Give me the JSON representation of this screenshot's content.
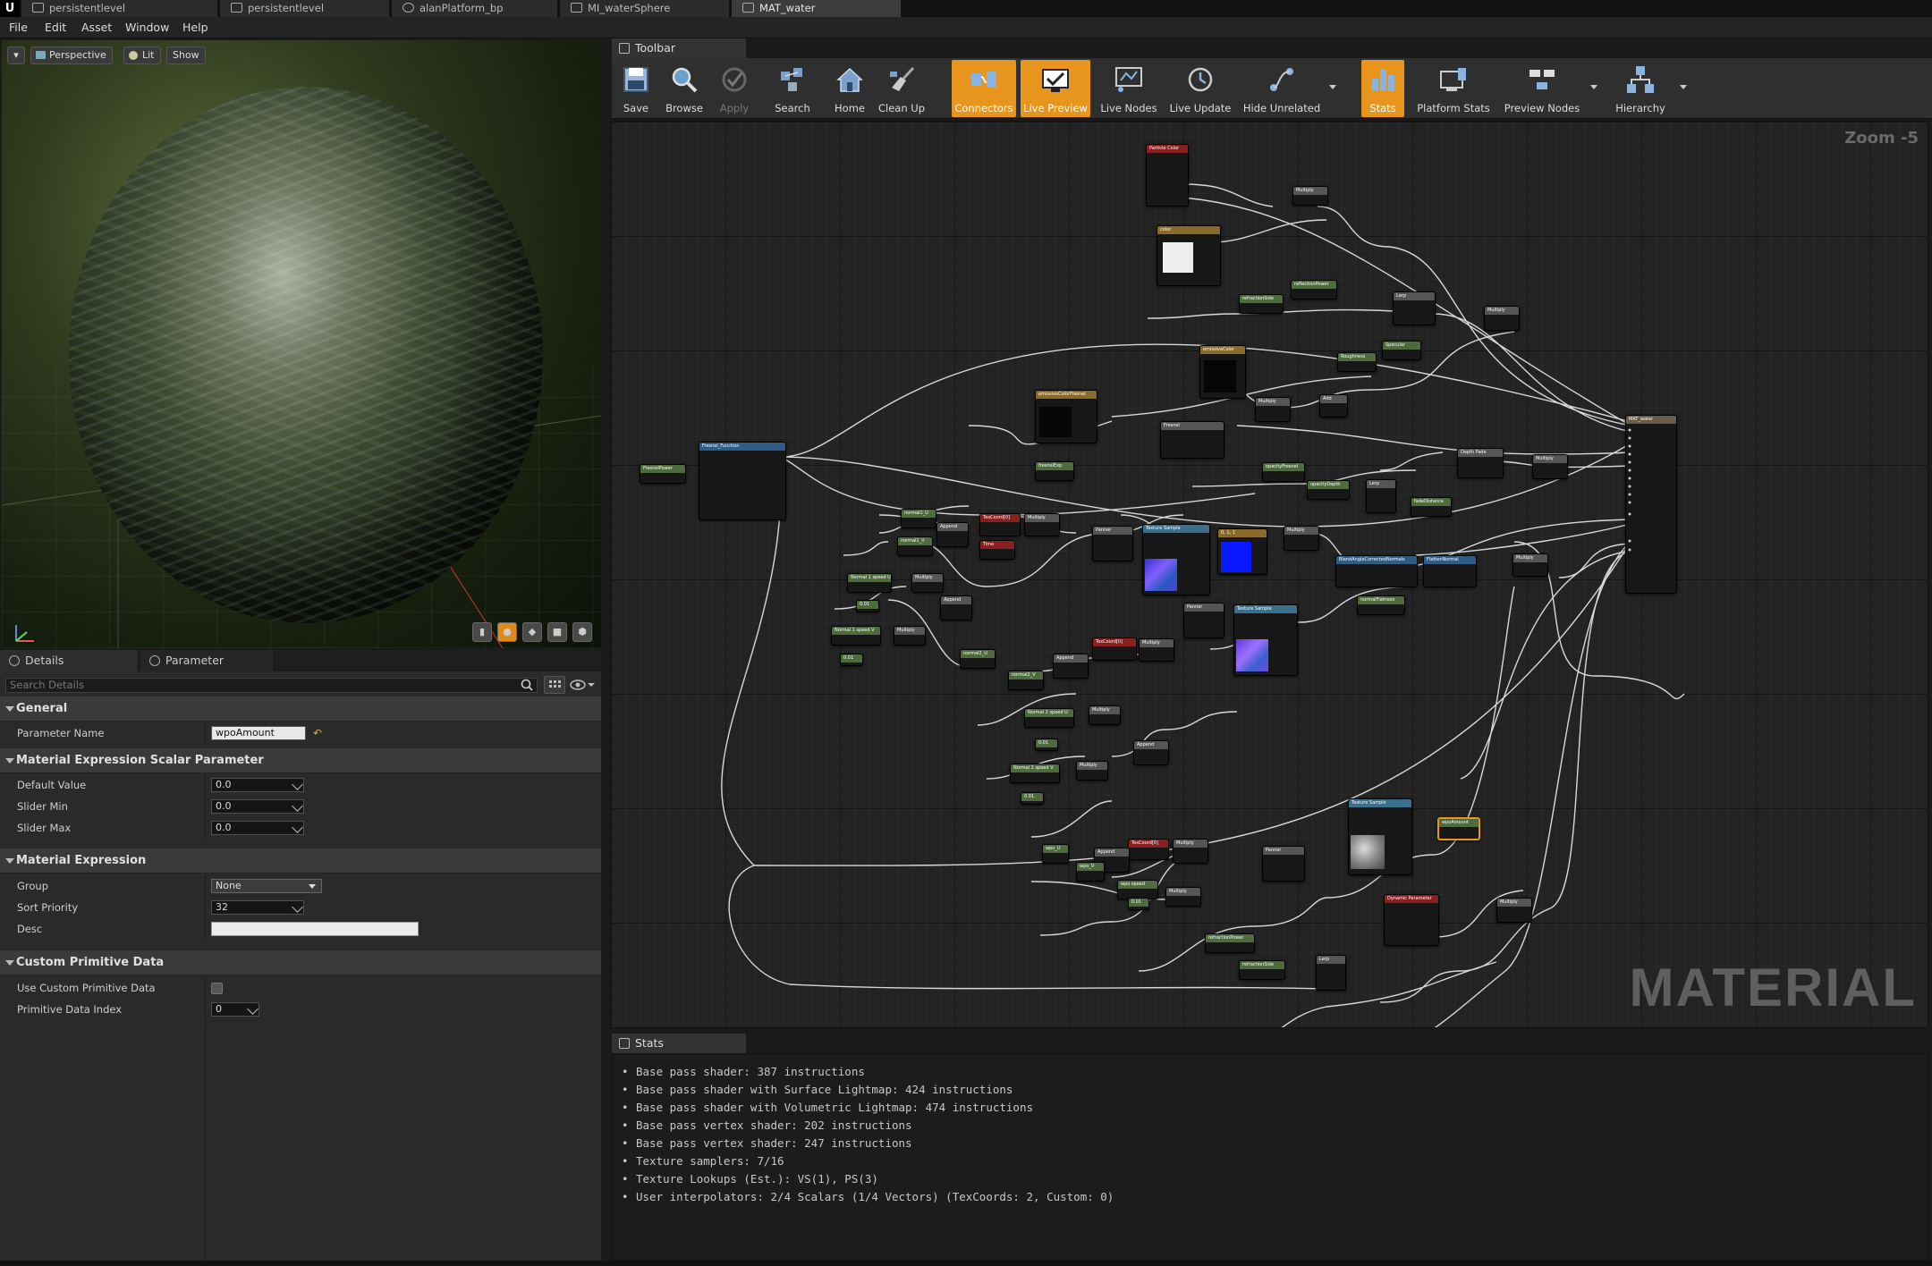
{
  "tabs": [
    {
      "label": "persistentlevel",
      "icon": "level-icon"
    },
    {
      "label": "persistentlevel",
      "icon": "level-icon"
    },
    {
      "label": "alanPlatform_bp",
      "icon": "blueprint-icon"
    },
    {
      "label": "MI_waterSphere",
      "icon": "material-instance-icon"
    },
    {
      "label": "MAT_water",
      "icon": "material-icon"
    }
  ],
  "menu": [
    "File",
    "Edit",
    "Asset",
    "Window",
    "Help"
  ],
  "viewport": {
    "mode": "Perspective",
    "lighting": "Lit",
    "show": "Show"
  },
  "details": {
    "tabs": [
      "Details",
      "Parameter Defaults"
    ],
    "search_placeholder": "Search Details",
    "categories": {
      "general": "General",
      "scalar": "Material Expression Scalar Parameter",
      "expr": "Material Expression",
      "cpd": "Custom Primitive Data"
    },
    "props": {
      "param_name_label": "Parameter Name",
      "param_name_value": "wpoAmount",
      "default_label": "Default Value",
      "default_value": "0.0",
      "slider_min_label": "Slider Min",
      "slider_min_value": "0.0",
      "slider_max_label": "Slider Max",
      "slider_max_value": "0.0",
      "group_label": "Group",
      "group_value": "None",
      "sort_label": "Sort Priority",
      "sort_value": "32",
      "desc_label": "Desc",
      "desc_value": "",
      "use_cpd_label": "Use Custom Primitive Data",
      "pdi_label": "Primitive Data Index",
      "pdi_value": "0"
    }
  },
  "toolbar": {
    "title": "Toolbar",
    "buttons": [
      {
        "label": "Save",
        "icon": "save-icon"
      },
      {
        "label": "Browse",
        "icon": "browse-icon"
      },
      {
        "label": "Apply",
        "icon": "apply-icon"
      },
      {
        "label": "Search",
        "icon": "search-icon"
      },
      {
        "label": "Home",
        "icon": "home-icon"
      },
      {
        "label": "Clean Up",
        "icon": "cleanup-icon"
      },
      {
        "label": "Connectors",
        "icon": "connectors-icon"
      },
      {
        "label": "Live Preview",
        "icon": "live-preview-icon"
      },
      {
        "label": "Live Nodes",
        "icon": "live-nodes-icon"
      },
      {
        "label": "Live Update",
        "icon": "live-update-icon"
      },
      {
        "label": "Hide Unrelated",
        "icon": "hide-unrelated-icon"
      },
      {
        "label": "Stats",
        "icon": "stats-icon"
      },
      {
        "label": "Platform Stats",
        "icon": "platform-stats-icon"
      },
      {
        "label": "Preview Nodes",
        "icon": "preview-nodes-icon"
      },
      {
        "label": "Hierarchy",
        "icon": "hierarchy-icon"
      }
    ]
  },
  "graph": {
    "zoom": "Zoom -5",
    "watermark": "MATERIAL"
  },
  "stats": {
    "title": "Stats",
    "lines": [
      "Base pass shader: 387 instructions",
      "Base pass shader with Surface Lightmap: 424 instructions",
      "Base pass shader with Volumetric Lightmap: 474 instructions",
      "Base pass vertex shader: 202 instructions",
      "Base pass vertex shader: 247 instructions",
      "Texture samplers: 7/16",
      "Texture Lookups (Est.): VS(1), PS(3)",
      "User interpolators: 2/4 Scalars (1/4 Vectors) (TexCoords: 2, Custom: 0)"
    ]
  },
  "colors": {
    "accent": "#e7951d",
    "node_param": "#4d6b3c",
    "node_texture": "#3b6f8c",
    "node_red": "#8a1f1f"
  }
}
